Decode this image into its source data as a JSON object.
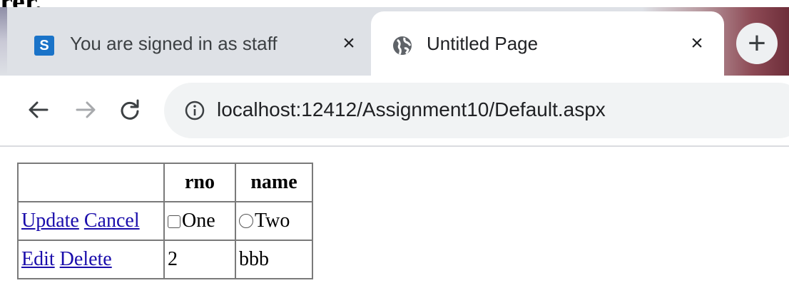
{
  "heading_fragment": "rer.",
  "browser": {
    "tabs": [
      {
        "title": "You are signed in as staff",
        "favicon": "s-logo-icon",
        "favicon_letter": "S",
        "close_label": "×",
        "active": false
      },
      {
        "title": "Untitled Page",
        "favicon": "globe-icon",
        "close_label": "×",
        "active": true
      }
    ],
    "new_tab_label": "+",
    "address": "localhost:12412/Assignment10/Default.aspx",
    "accent_color": "#1a73c8"
  },
  "grid": {
    "headers": [
      "",
      "rno",
      "name"
    ],
    "edit_row": {
      "actions": [
        "Update",
        "Cancel"
      ],
      "rno_option": "One",
      "name_option": "Two"
    },
    "data_row": {
      "actions": [
        "Edit",
        "Delete"
      ],
      "rno": "2",
      "name": "bbb"
    }
  }
}
